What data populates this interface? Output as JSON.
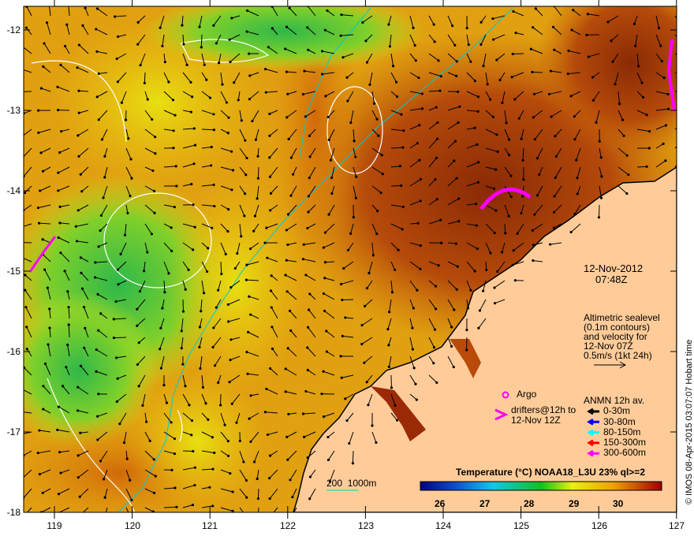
{
  "date": "12-Nov-2012",
  "time": "07:48Z",
  "altimetry": {
    "lines": [
      "Altimetric sealevel",
      "(0.1m contours)",
      "and velocity for",
      "12-Nov 07Z",
      "0.5m/s (1kt 24h)"
    ]
  },
  "argo_label": "Argo",
  "drifters": {
    "lines": [
      "drifters@12h to",
      "12-Nov 12Z"
    ]
  },
  "anmn": {
    "title": "ANMN 12h av.",
    "items": [
      {
        "label": "0-30m",
        "color": "#000000"
      },
      {
        "label": "30-80m",
        "color": "#0000ff"
      },
      {
        "label": "80-150m",
        "color": "#00ffff"
      },
      {
        "label": "150-300m",
        "color": "#ff0000"
      },
      {
        "label": "300-600m",
        "color": "#ff00ff"
      }
    ]
  },
  "isobath_label": "200  1000m",
  "colorbar": {
    "title": "Temperature (°C) NOAA18_L3U 23% ql>=2",
    "ticks": [
      "26",
      "27",
      "28",
      "29",
      "30"
    ],
    "range": [
      25.7,
      31.1
    ]
  },
  "axes": {
    "lat_ticks": [
      "-12",
      "-13",
      "-14",
      "-15",
      "-16",
      "-17",
      "-18"
    ],
    "lon_ticks": [
      "119",
      "120",
      "121",
      "122",
      "123",
      "124",
      "125",
      "126",
      "127"
    ]
  },
  "credit": "© IMOS 08-Apr-2015 03:07:07 Hobart time",
  "colors": {
    "land": "#ffcc99",
    "isobath": "#00cccc",
    "contour": "#ffffff"
  }
}
